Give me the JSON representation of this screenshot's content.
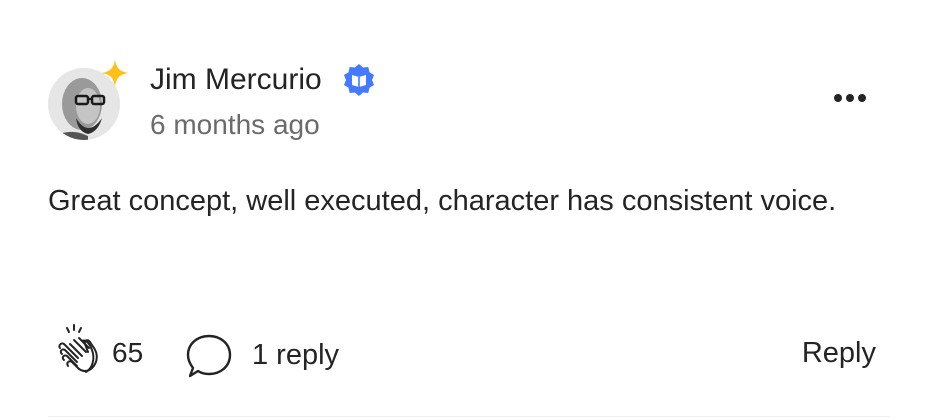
{
  "comment": {
    "author": {
      "name": "Jim Mercurio",
      "verified_badge_icon": "verified-badge-icon",
      "avatar_accent_icon": "sparkle-icon",
      "accent_color": "#FFC017",
      "badge_color": "#437AFF"
    },
    "timestamp": "6 months ago",
    "text": "Great concept, well executed, character has consistent voice.",
    "actions": {
      "clap_icon": "clap-icon",
      "clap_count": "65",
      "reply_icon": "speech-bubble-icon",
      "reply_count_label": "1 reply",
      "reply_label": "Reply",
      "more_icon": "more-horizontal-icon"
    }
  }
}
